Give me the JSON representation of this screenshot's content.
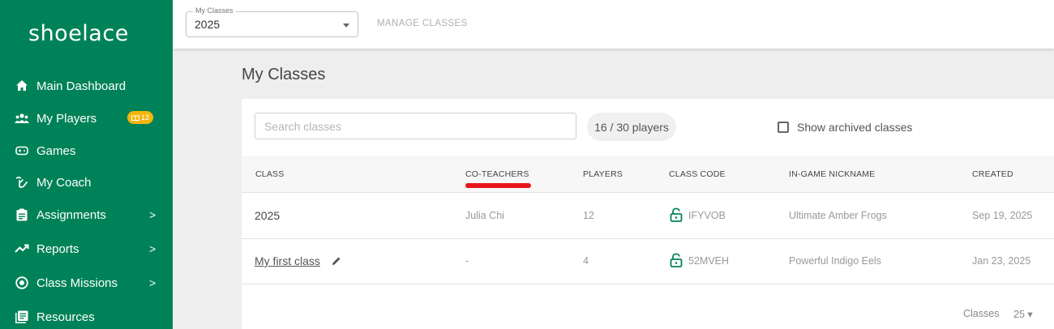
{
  "brand": {
    "logo_text": "shoelace",
    "accent": "#008259"
  },
  "sidebar": {
    "items": [
      {
        "label": "Main Dashboard",
        "icon": "home-icon"
      },
      {
        "label": "My Players",
        "icon": "players-icon",
        "badge": "12"
      },
      {
        "label": "Games",
        "icon": "gamepad-icon"
      },
      {
        "label": "My Coach",
        "icon": "coach-icon"
      },
      {
        "label": "Assignments",
        "icon": "clipboard-icon",
        "chevron": ">"
      },
      {
        "label": "Reports",
        "icon": "trending-icon",
        "chevron": ">"
      },
      {
        "label": "Class Missions",
        "icon": "missions-icon",
        "chevron": ">"
      },
      {
        "label": "Resources",
        "icon": "resources-icon"
      }
    ]
  },
  "topbar": {
    "select_label": "My Classes",
    "select_value": "2025",
    "manage_label": "MANAGE CLASSES"
  },
  "main": {
    "title": "My Classes",
    "search_placeholder": "Search classes",
    "players_count": "16 / 30 players",
    "archived_label": "Show archived classes",
    "columns": [
      "CLASS",
      "CO-TEACHERS",
      "PLAYERS",
      "CLASS CODE",
      "IN-GAME NICKNAME",
      "CREATED"
    ],
    "rows": [
      {
        "class": "2025",
        "co_teachers": "Julia Chi",
        "players": "12",
        "code": "IFYVOB",
        "nickname": "Ultimate Amber Frogs",
        "created": "Sep 19, 2025"
      },
      {
        "class": "My first class",
        "co_teachers": "-",
        "players": "4",
        "code": "52MVEH",
        "nickname": "Powerful Indigo Eels",
        "created": "Jan 23, 2025"
      }
    ],
    "footer_label": "Classes",
    "footer_value": "25 ▾",
    "highlight_color": "#e8141c"
  }
}
